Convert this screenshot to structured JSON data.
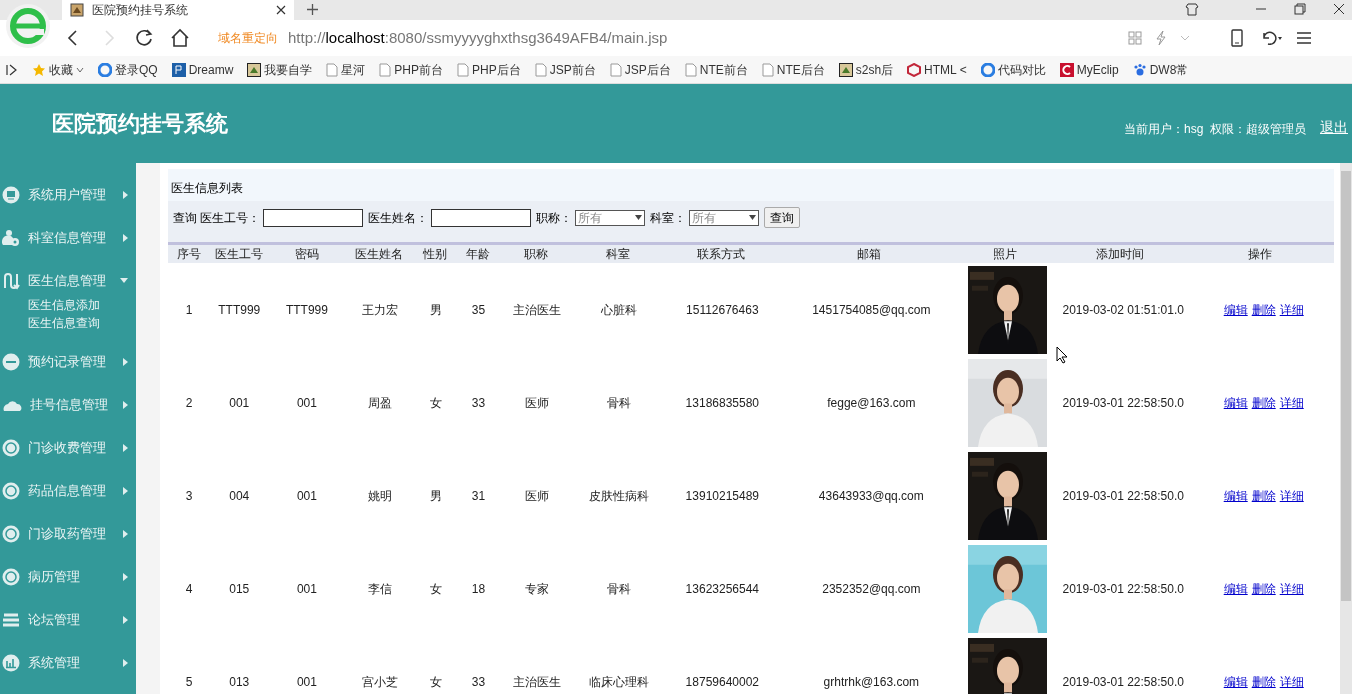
{
  "browser": {
    "tab_title": "医院预约挂号系统",
    "redirect_label": "域名重定向",
    "url_prefix": "http://",
    "url_host": "localhost",
    "url_rest": ":8080/ssmyyyyghxthsg3649AFB4/main.jsp",
    "bookmarks": [
      {
        "label": "收藏"
      },
      {
        "label": "登录QQ"
      },
      {
        "label": "Dreamw"
      },
      {
        "label": "我要自学"
      },
      {
        "label": "星河"
      },
      {
        "label": "PHP前台"
      },
      {
        "label": "PHP后台"
      },
      {
        "label": "JSP前台"
      },
      {
        "label": "JSP后台"
      },
      {
        "label": "NTE前台"
      },
      {
        "label": "NTE后台"
      },
      {
        "label": "s2sh后"
      },
      {
        "label": "HTML <"
      },
      {
        "label": "代码对比"
      },
      {
        "label": "MyEclip"
      },
      {
        "label": "DW8常"
      }
    ]
  },
  "header": {
    "title": "医院预约挂号系统",
    "user_info": "当前用户：hsg  权限：超级管理员",
    "logout": "退出"
  },
  "sidebar": {
    "items": [
      {
        "label": "系统用户管理",
        "expanded": false
      },
      {
        "label": "科室信息管理",
        "expanded": false
      },
      {
        "label": "医生信息管理",
        "expanded": true,
        "children": [
          {
            "label": "医生信息添加"
          },
          {
            "label": "医生信息查询"
          }
        ]
      },
      {
        "label": "预约记录管理",
        "expanded": false
      },
      {
        "label": "挂号信息管理",
        "expanded": false
      },
      {
        "label": "门诊收费管理",
        "expanded": false
      },
      {
        "label": "药品信息管理",
        "expanded": false
      },
      {
        "label": "门诊取药管理",
        "expanded": false
      },
      {
        "label": "病历管理",
        "expanded": false
      },
      {
        "label": "论坛管理",
        "expanded": false
      },
      {
        "label": "系统管理",
        "expanded": false
      }
    ]
  },
  "panel": {
    "title": "医生信息列表",
    "search": {
      "label": "查询",
      "fields": [
        {
          "kind": "input",
          "label": "医生工号："
        },
        {
          "kind": "input",
          "label": "医生姓名："
        },
        {
          "kind": "select",
          "label": "职称：",
          "value": "所有"
        },
        {
          "kind": "select",
          "label": "科室：",
          "value": "所有"
        }
      ],
      "button": "查询"
    },
    "table": {
      "columns": [
        "序号",
        "医生工号",
        "密码",
        "医生姓名",
        "性别",
        "年龄",
        "职称",
        "科室",
        "联系方式",
        "邮箱",
        "照片",
        "添加时间",
        "操作"
      ],
      "rows": [
        {
          "cells": [
            "1",
            "TTT999",
            "TTT999",
            "王力宏",
            "男",
            "35",
            "主治医生",
            "心脏科",
            "15112676463",
            "1451754085@qq.com"
          ],
          "added": "2019-03-02 01:51:01.0",
          "actions": [
            "编辑",
            "删除",
            "详细"
          ]
        },
        {
          "cells": [
            "2",
            "001",
            "001",
            "周盈",
            "女",
            "33",
            "医师",
            "骨科",
            "13186835580",
            "fegge@163.com"
          ],
          "added": "2019-03-01 22:58:50.0",
          "actions": [
            "编辑",
            "删除",
            "详细"
          ]
        },
        {
          "cells": [
            "3",
            "004",
            "001",
            "姚明",
            "男",
            "31",
            "医师",
            "皮肤性病科",
            "13910215489",
            "43643933@qq.com"
          ],
          "added": "2019-03-01 22:58:50.0",
          "actions": [
            "编辑",
            "删除",
            "详细"
          ]
        },
        {
          "cells": [
            "4",
            "015",
            "001",
            "李信",
            "女",
            "18",
            "专家",
            "骨科",
            "13623256544",
            "2352352@qq.com"
          ],
          "added": "2019-03-01 22:58:50.0",
          "actions": [
            "编辑",
            "删除",
            "详细"
          ]
        },
        {
          "cells": [
            "5",
            "013",
            "001",
            "宫小芝",
            "女",
            "33",
            "主治医生",
            "临床心理科",
            "18759640002",
            "grhtrhk@163.com"
          ],
          "added": "2019-03-01 22:58:50.0",
          "actions": [
            "编辑",
            "删除",
            "详细"
          ]
        }
      ]
    }
  }
}
